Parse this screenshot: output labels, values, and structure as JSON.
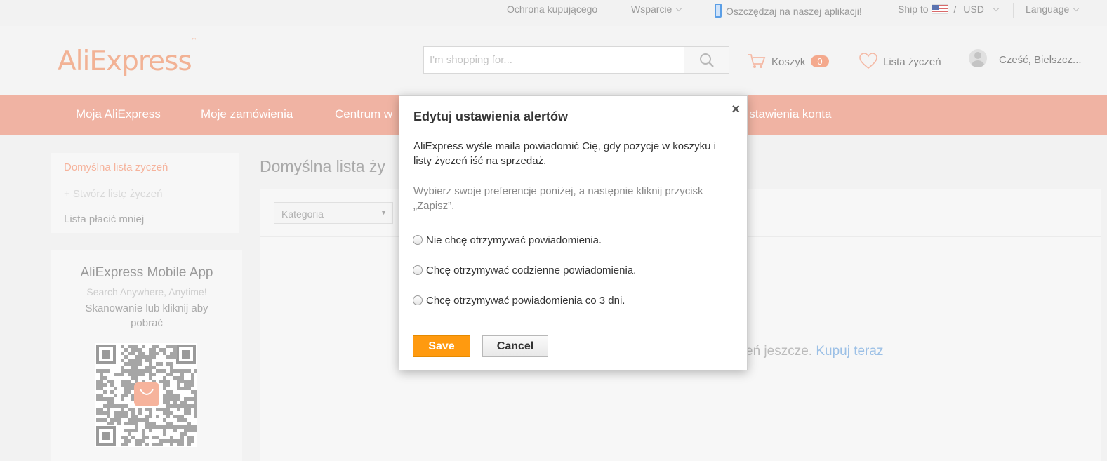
{
  "topbar": {
    "buyer_protection": "Ochrona kupującego",
    "support": "Wsparcie",
    "app_promo": "Oszczędzaj na naszej aplikacji!",
    "ship_to": "Ship to",
    "currency_sep": "/",
    "currency": "USD",
    "language": "Language"
  },
  "header": {
    "logo": "AliExpress",
    "logo_tm": "™",
    "search_placeholder": "I'm shopping for...",
    "cart_label": "Koszyk",
    "cart_count": "0",
    "wishlist_label": "Lista życzeń",
    "greeting": "Cześć, Bielszcz..."
  },
  "nav": {
    "items": [
      "Moja AliExpress",
      "Moje zamówienia",
      "Centrum w",
      "Ustawienia konta"
    ]
  },
  "sidebar": {
    "items": [
      "Domyślna lista życzeń",
      "+ Stwórz listę życzeń",
      "Lista płacić mniej"
    ],
    "app_title": "AliExpress Mobile App",
    "app_subtitle": "Search Anywhere, Anytime!",
    "app_desc": "Skanowanie lub kliknij aby pobrać"
  },
  "main": {
    "title": "Domyślna lista ży",
    "category_select": "Kategoria",
    "empty_text": "czeń jeszcze.",
    "empty_link": "Kupuj teraz"
  },
  "modal": {
    "title": "Edytuj ustawienia alertów",
    "close": "×",
    "paragraph1": "AliExpress wyśle maila powiadomić Cię, gdy pozycje w koszyku i listy życzeń iść na sprzedaż.",
    "paragraph2": "Wybierz swoje preferencje poniżej, a następnie kliknij przycisk „Zapisz”.",
    "options": [
      "Nie chcę otrzymywać powiadomienia.",
      "Chcę otrzymywać codzienne powiadomienia.",
      "Chcę otrzymywać powiadomienia co 3 dni."
    ],
    "save_label": "Save",
    "cancel_label": "Cancel"
  },
  "colors": {
    "nav_bg": "#f0b3a3",
    "logo": "#f2b295",
    "save_button": "#ff9a0f",
    "link": "#9cc0e6"
  }
}
